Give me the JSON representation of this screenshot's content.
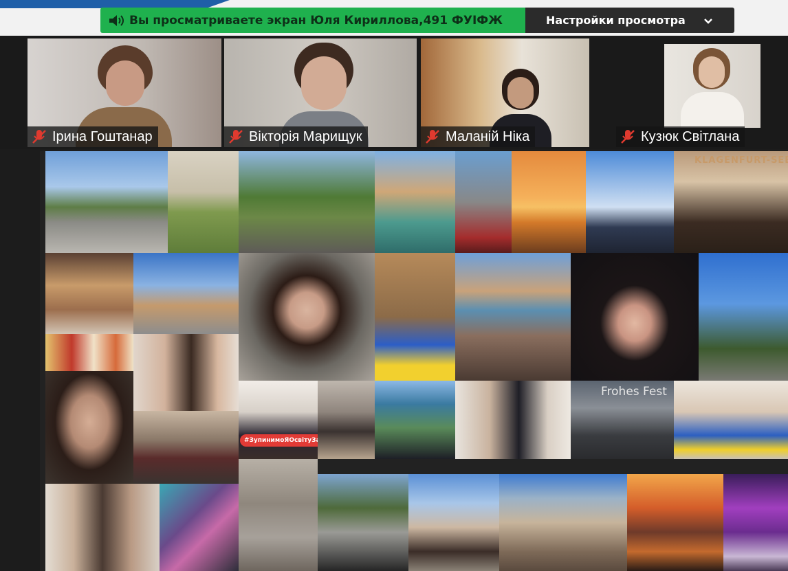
{
  "share_banner": {
    "text": "Вы просматриваете экран Юля Кириллова,491 ФУІФЖ",
    "icon": "speaker-icon",
    "color": "#1fb14e"
  },
  "view_options": {
    "label": "Настройки просмотра",
    "icon": "chevron-down-icon"
  },
  "participants": [
    {
      "name": "Ірина Гоштанар",
      "mic": "muted"
    },
    {
      "name": "Вікторія Марищук",
      "mic": "muted"
    },
    {
      "name": "Маланій Ніка",
      "mic": "muted"
    },
    {
      "name": "Кузюк Світлана",
      "mic": "muted"
    }
  ],
  "collage": {
    "badge_text": "#ЗупинимоЯОсвітуЗаражно",
    "sign_text": "KLAGENFURT-SEE",
    "fest_text": "Frohes Fest"
  }
}
